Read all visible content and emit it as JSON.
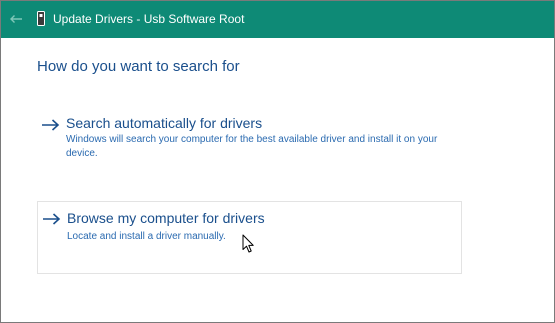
{
  "window": {
    "title": "Update Drivers - Usb Software Root",
    "accent_color": "#0e8a76"
  },
  "icons": {
    "back": "back-arrow-icon",
    "device": "usb-device-icon",
    "option_arrow": "right-arrow-icon",
    "cursor": "mouse-pointer-icon"
  },
  "content": {
    "heading": "How do you want to search for",
    "options": [
      {
        "title": "Search automatically for drivers",
        "description": "Windows will search your computer for the best available driver and install it on your device."
      },
      {
        "title": "Browse my computer for drivers",
        "description": "Locate and install a driver manually."
      }
    ]
  }
}
